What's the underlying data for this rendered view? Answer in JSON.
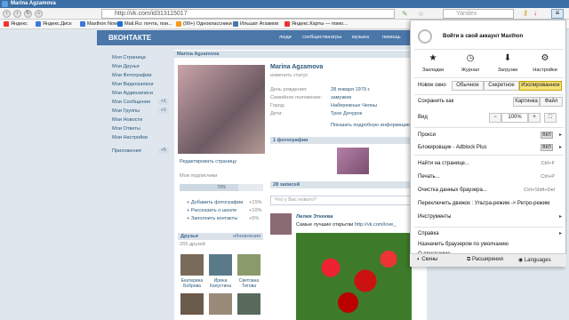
{
  "window": {
    "title": "Marina Agzamova"
  },
  "address": {
    "url": "http://vk.com/id313115017",
    "search": "Yandex"
  },
  "bookmarks": [
    {
      "label": "Яндекс",
      "color": "#e33"
    },
    {
      "label": "Яндекс.Диск",
      "color": "#3a7bd5"
    },
    {
      "label": "Maxthon Now",
      "color": "#3a7bd5"
    },
    {
      "label": "Mail.Ru: почта, пои...",
      "color": "#1a6fd1"
    },
    {
      "label": "(99+) Одноклассники",
      "color": "#f29a1b"
    },
    {
      "label": "Ильшат Агзамов",
      "color": "#4a76a8"
    },
    {
      "label": "Яндекс.Карты — помо...",
      "color": "#e33"
    }
  ],
  "vk": {
    "logo": "ВКОНТАКТЕ",
    "nav": [
      "люди",
      "сообщества",
      "игры",
      "музыка",
      "помощь"
    ],
    "left_menu": [
      "Моя Страница",
      "Мои Друзья",
      "Мои Фотографии",
      "Мои Видеозаписи",
      "Мои Аудиозаписи",
      "Мои Сообщения",
      "Мои Группы",
      "Мои Новости",
      "Мои Ответы",
      "Мои Настройки",
      "Приложения"
    ],
    "badges": [
      "+1",
      "+1",
      "+5"
    ],
    "profile_header": "Marina Agzamova",
    "name": "Marina Agzamova",
    "status": "изменить статус",
    "info": [
      {
        "label": "День рождения:",
        "value": "28 января 1979 г."
      },
      {
        "label": "Семейное положение:",
        "value": "замужем"
      },
      {
        "label": "Город:",
        "value": "Набережные Челны"
      },
      {
        "label": "Дети:",
        "value": "Трое Дочурок"
      }
    ],
    "more_info": "Показать подробную информацию",
    "edit_page": "Редактировать страницу",
    "subscribers": "Мои подписчики",
    "progress_label": "70%",
    "progress": 0.7,
    "actions": [
      {
        "label": "Добавить фотографии",
        "value": "+15%"
      },
      {
        "label": "Рассказать о школе",
        "value": "+10%"
      },
      {
        "label": "Заполнить контакты",
        "value": "+5%"
      }
    ],
    "friends_header": "Друзья",
    "friends_update": "обновления",
    "friends_count": "255 друзей",
    "friends": [
      "Екатерина Боброва",
      "Ирина Капустина",
      "Светлана Титова"
    ],
    "photos_header": "1 фотография",
    "wall_header": "28 записей",
    "wall_placeholder": "Что у Вас нового?",
    "post_author": "Лилия Эткеева",
    "post_text": "Самые лучшие открытки",
    "post_link": "http://vk.com/love_"
  },
  "menu": {
    "login": "Войти в свой аккаунт Maxthon",
    "toolbar": [
      "Закладки",
      "Журнал",
      "Загрузки",
      "Настройки"
    ],
    "window_mode": "Новое окно",
    "modes": [
      "Обычное",
      "Секретное",
      "Изолированное"
    ],
    "save_as": "Сохранить как",
    "save_opts": [
      "Картинка",
      "Файл"
    ],
    "view": "Вид",
    "zoom": "100%",
    "proxy": "Прокси",
    "proxy_state": "ВКЛ",
    "adblock": "Блокировщик - Adblock Plus",
    "adblock_state": "ВКЛ",
    "items": [
      {
        "label": "Найти на странице...",
        "shortcut": "Ctrl+F"
      },
      {
        "label": "Печать...",
        "shortcut": "Ctrl+P"
      },
      {
        "label": "Очистка данных браузера...",
        "shortcut": "Ctrl+Shift+Del"
      },
      {
        "label": "Переключить движок : Ультра-режим -> Ретро-режим",
        "shortcut": ""
      },
      {
        "label": "Инструменты",
        "shortcut": ""
      }
    ],
    "help": "Справка",
    "default": "Назначить браузером по умолчанию",
    "about": "О программе...",
    "footer": [
      "Скины",
      "Расширения",
      "Languages"
    ]
  },
  "colors": {
    "accent": "#4a76a8",
    "selected_mode": "#f5e27a"
  }
}
